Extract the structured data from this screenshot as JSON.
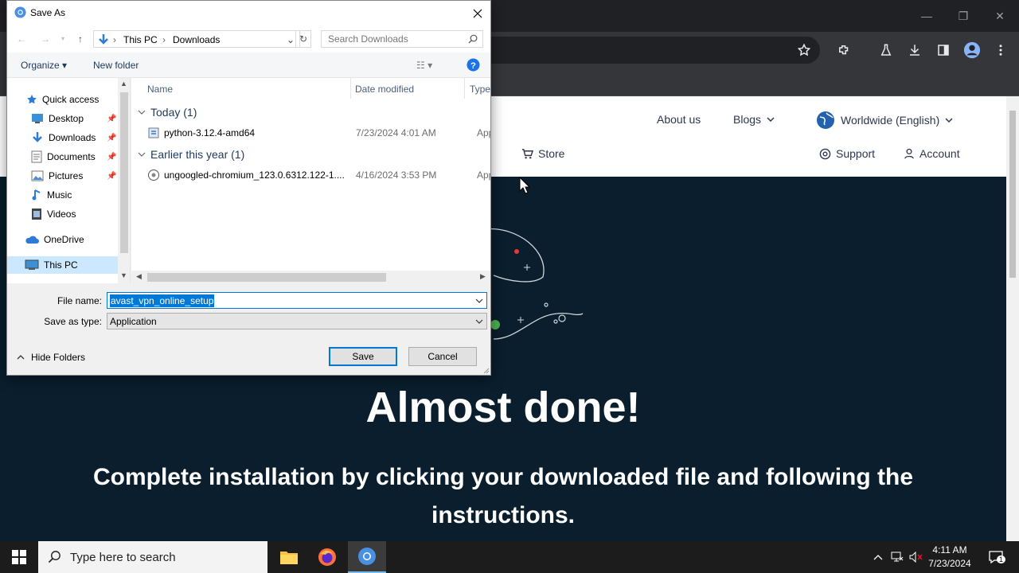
{
  "browser": {
    "window_controls": [
      "—",
      "❐",
      "✕"
    ],
    "toolbar_icons": [
      "star-icon",
      "extensions-icon",
      "labs-icon",
      "downloads-icon",
      "side-panel-icon",
      "profile-icon",
      "menu-icon"
    ]
  },
  "webpage": {
    "nav_top": {
      "about": "About us",
      "blogs": "Blogs",
      "region": "Worldwide (English)"
    },
    "nav_bottom": {
      "store": "Store",
      "support": "Support",
      "account": "Account"
    },
    "hero_title": "Almost done!",
    "hero_subtitle": "Complete installation by clicking your downloaded file and following the instructions."
  },
  "dialog": {
    "title": "Save As",
    "breadcrumb": [
      "This PC",
      "Downloads"
    ],
    "search_placeholder": "Search Downloads",
    "organize": "Organize ▾",
    "new_folder": "New folder",
    "nav_items": [
      {
        "label": "Quick access"
      },
      {
        "label": "Desktop"
      },
      {
        "label": "Downloads"
      },
      {
        "label": "Documents"
      },
      {
        "label": "Pictures"
      },
      {
        "label": "Music"
      },
      {
        "label": "Videos"
      },
      {
        "label": "OneDrive"
      },
      {
        "label": "This PC"
      }
    ],
    "columns": {
      "name": "Name",
      "date": "Date modified",
      "type": "Type"
    },
    "groups": [
      {
        "header": "Today (1)",
        "files": [
          {
            "name": "python-3.12.4-amd64",
            "date": "7/23/2024 4:01 AM",
            "type": "Appli"
          }
        ]
      },
      {
        "header": "Earlier this year (1)",
        "files": [
          {
            "name": "ungoogled-chromium_123.0.6312.122-1....",
            "date": "4/16/2024 3:53 PM",
            "type": "Appli"
          }
        ]
      }
    ],
    "file_name_label": "File name:",
    "file_name_value": "avast_vpn_online_setup",
    "save_type_label": "Save as type:",
    "save_type_value": "Application",
    "hide_folders": "Hide Folders",
    "save": "Save",
    "cancel": "Cancel"
  },
  "taskbar": {
    "search_placeholder": "Type here to search",
    "time": "4:11 AM",
    "date": "7/23/2024",
    "notification_count": "1"
  },
  "colors": {
    "accent": "#0078d7",
    "page_bg": "#0a1e2d",
    "browser_bg": "#35363a"
  }
}
